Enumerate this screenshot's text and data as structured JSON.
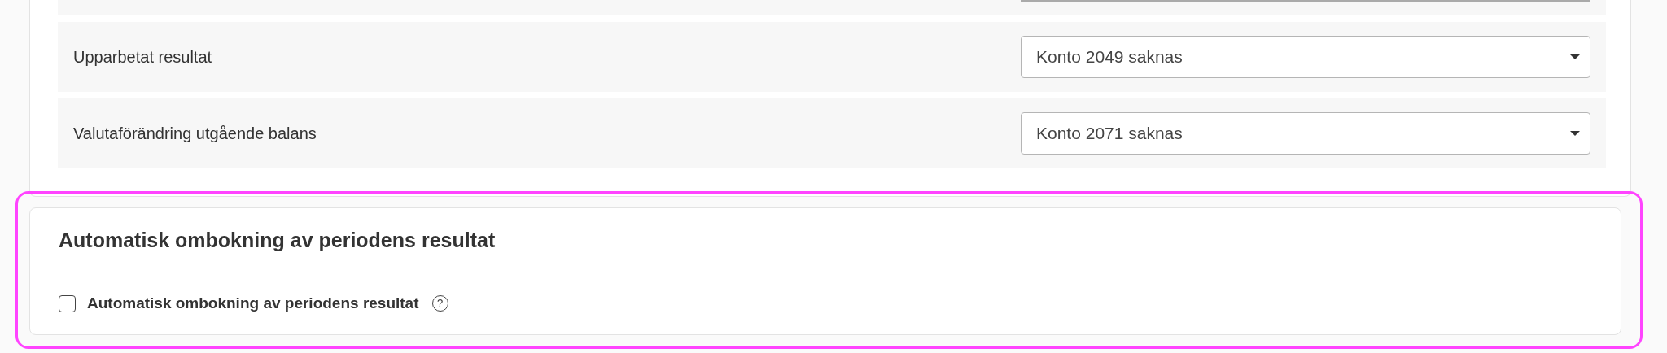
{
  "account_rows": [
    {
      "label": "Upparbetat resultat",
      "value": "Konto 2049 saknas"
    },
    {
      "label": "Valutaförändring utgående balans",
      "value": "Konto 2071 saknas"
    }
  ],
  "section": {
    "title": "Automatisk ombokning av periodens resultat",
    "highlighted": true,
    "checkbox": {
      "label": "Automatisk ombokning av periodens resultat",
      "checked": false,
      "help": "?"
    }
  }
}
